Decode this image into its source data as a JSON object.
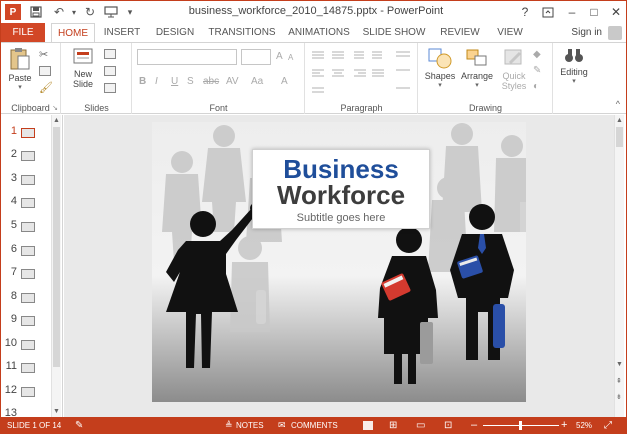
{
  "window": {
    "title": "business_workforce_2010_14875.pptx - PowerPoint",
    "help_label": "?",
    "restore_icon": "ribbon-display-icon",
    "minimize_label": "–",
    "maximize_label": "□",
    "close_label": "✕"
  },
  "quick_access": {
    "app_icon": "P",
    "save_icon": "save-icon",
    "undo_icon": "↶",
    "redo_icon": "↻",
    "present_icon": "present-icon",
    "customize_icon": "▾"
  },
  "tabs": [
    "FILE",
    "HOME",
    "INSERT",
    "DESIGN",
    "TRANSITIONS",
    "ANIMATIONS",
    "SLIDE SHOW",
    "REVIEW",
    "VIEW"
  ],
  "account": {
    "signin_label": "Sign in"
  },
  "ribbon": {
    "clipboard": {
      "label": "Clipboard",
      "paste_label": "Paste"
    },
    "slides": {
      "label": "Slides",
      "new_slide_label": "New",
      "new_slide_label2": "Slide"
    },
    "font": {
      "label": "Font",
      "bold": "B",
      "italic": "I",
      "underline": "U",
      "shadow": "S",
      "strike": "abc",
      "spacing": "AV",
      "grow": "A",
      "shrink": "A",
      "case": "Aa",
      "color": "A"
    },
    "paragraph": {
      "label": "Paragraph"
    },
    "drawing": {
      "label": "Drawing",
      "shapes_label": "Shapes",
      "arrange_label": "Arrange",
      "quick_styles_label": "Quick",
      "quick_styles_label2": "Styles"
    },
    "editing": {
      "label": "Editing"
    }
  },
  "slide_panel": {
    "slides": [
      "1",
      "2",
      "3",
      "4",
      "5",
      "6",
      "7",
      "8",
      "9",
      "10",
      "11",
      "12",
      "13"
    ],
    "selected": 1
  },
  "slide": {
    "title_line1": "Business",
    "title_line2": "Workforce",
    "subtitle": "Subtitle goes here"
  },
  "status": {
    "slide_info": "SLIDE 1 OF 14",
    "notes_label": "NOTES",
    "comments_label": "COMMENTS",
    "zoom_minus": "–",
    "zoom_plus": "+",
    "zoom_level": "52%"
  },
  "colors": {
    "accent": "#c43e1c",
    "title_blue": "#1f4e9a",
    "book_red": "#d43a2f",
    "book_blue": "#2a4fa8"
  }
}
